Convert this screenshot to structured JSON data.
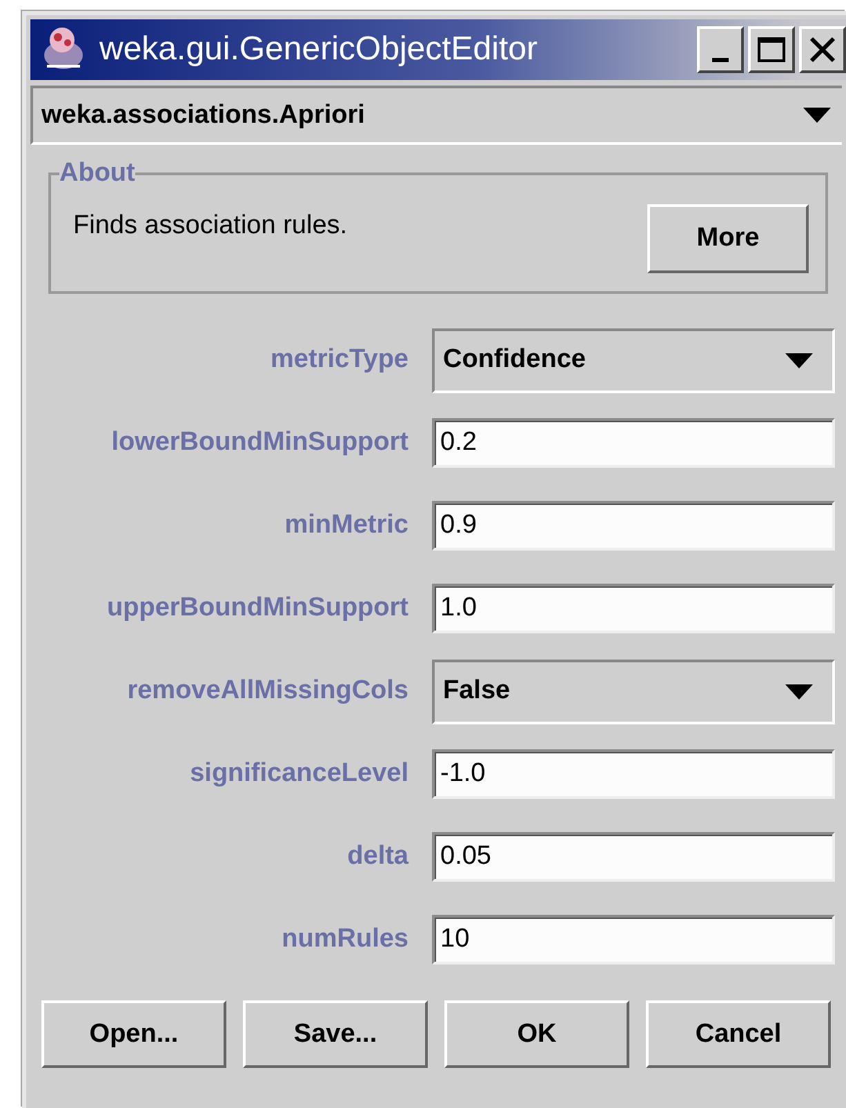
{
  "window": {
    "title": "weka.gui.GenericObjectEditor"
  },
  "class_chooser": {
    "value": "weka.associations.Apriori"
  },
  "about": {
    "legend": "About",
    "text": "Finds association rules.",
    "button": "More"
  },
  "properties": [
    {
      "label": "metricType",
      "kind": "choice",
      "value": "Confidence"
    },
    {
      "label": "lowerBoundMinSupport",
      "kind": "text",
      "value": "0.2"
    },
    {
      "label": "minMetric",
      "kind": "text",
      "value": "0.9"
    },
    {
      "label": "upperBoundMinSupport",
      "kind": "text",
      "value": "1.0"
    },
    {
      "label": "removeAllMissingCols",
      "kind": "choice",
      "value": "False"
    },
    {
      "label": "significanceLevel",
      "kind": "text",
      "value": "-1.0"
    },
    {
      "label": "delta",
      "kind": "text",
      "value": "0.05"
    },
    {
      "label": "numRules",
      "kind": "text",
      "value": "10"
    }
  ],
  "buttons": [
    "Open...",
    "Save...",
    "OK",
    "Cancel"
  ]
}
